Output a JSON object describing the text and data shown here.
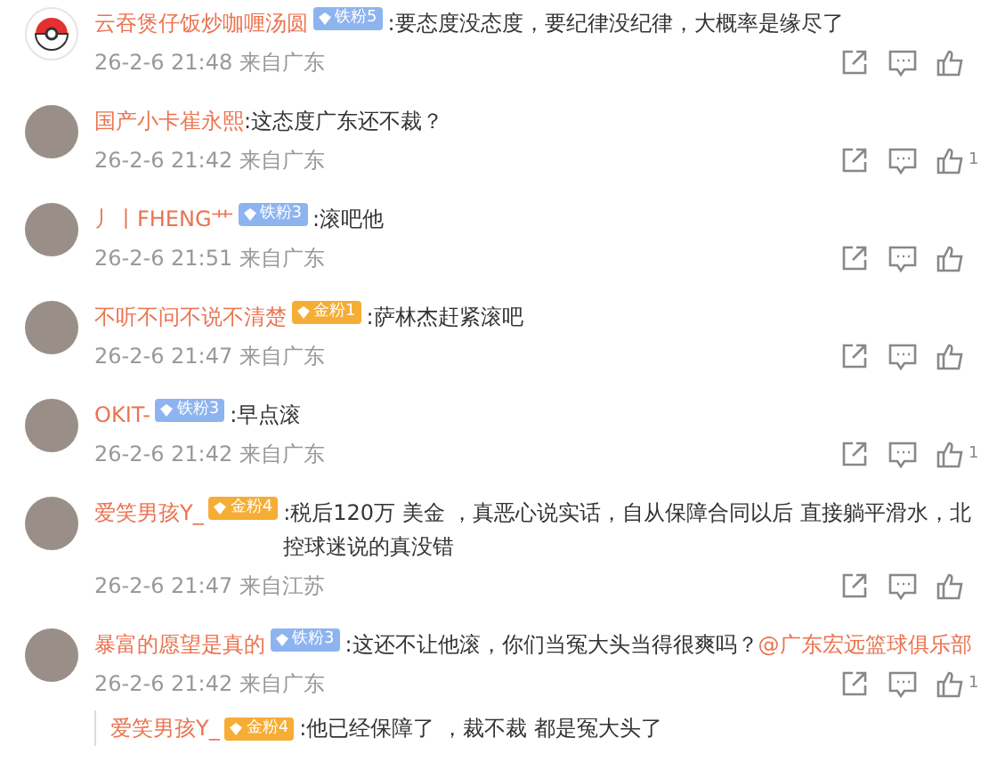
{
  "comments": [
    {
      "kind": "logo",
      "name": "云吞煲仔饭炒咖喱汤圆",
      "badge": {
        "kind": "iron",
        "label": "铁粉5"
      },
      "text": ":要态度没态度，要纪律没纪律，大概率是缘尽了",
      "time": "26-2-6 21:48",
      "location": "来自广东"
    },
    {
      "kind": "photo",
      "name": "国产小卡崔永熙",
      "text": ":这态度广东还不裁？",
      "time": "26-2-6 21:42",
      "location": "来自广东",
      "likes": "1"
    },
    {
      "kind": "photo",
      "name": "丿丨FHENG艹",
      "badge": {
        "kind": "iron",
        "label": "铁粉3"
      },
      "text": ":滚吧他",
      "time": "26-2-6 21:51",
      "location": "来自广东"
    },
    {
      "kind": "photo",
      "name": "不听不问不说不清楚",
      "badge": {
        "kind": "gold",
        "label": "金粉1"
      },
      "text": ":萨林杰赶紧滚吧",
      "time": "26-2-6 21:47",
      "location": "来自广东"
    },
    {
      "kind": "photo",
      "name": "OKIT-",
      "badge": {
        "kind": "iron",
        "label": "铁粉3"
      },
      "text": ":早点滚",
      "time": "26-2-6 21:42",
      "location": "来自广东",
      "likes": "1"
    },
    {
      "kind": "photo",
      "name": "爱笑男孩Y_",
      "badge": {
        "kind": "gold",
        "label": "金粉4"
      },
      "text": ":税后120万 美金 ，真恶心说实话，自从保障合同以后 直接躺平滑水，北控球迷说的真没错",
      "time": "26-2-6 21:47",
      "location": "来自江苏"
    },
    {
      "kind": "photo",
      "name": "暴富的愿望是真的",
      "badge": {
        "kind": "iron",
        "label": "铁粉3"
      },
      "text": ":这还不让他滚，你们当冤大头当得很爽吗？",
      "mention": "@广东宏远篮球俱乐部",
      "time": "26-2-6 21:42",
      "location": "来自广东",
      "likes": "1"
    }
  ],
  "reply": {
    "name": "爱笑男孩Y_",
    "badge": {
      "kind": "gold",
      "label": "金粉4"
    },
    "text": ":他已经保障了 ，裁不裁 都是冤大头了"
  }
}
